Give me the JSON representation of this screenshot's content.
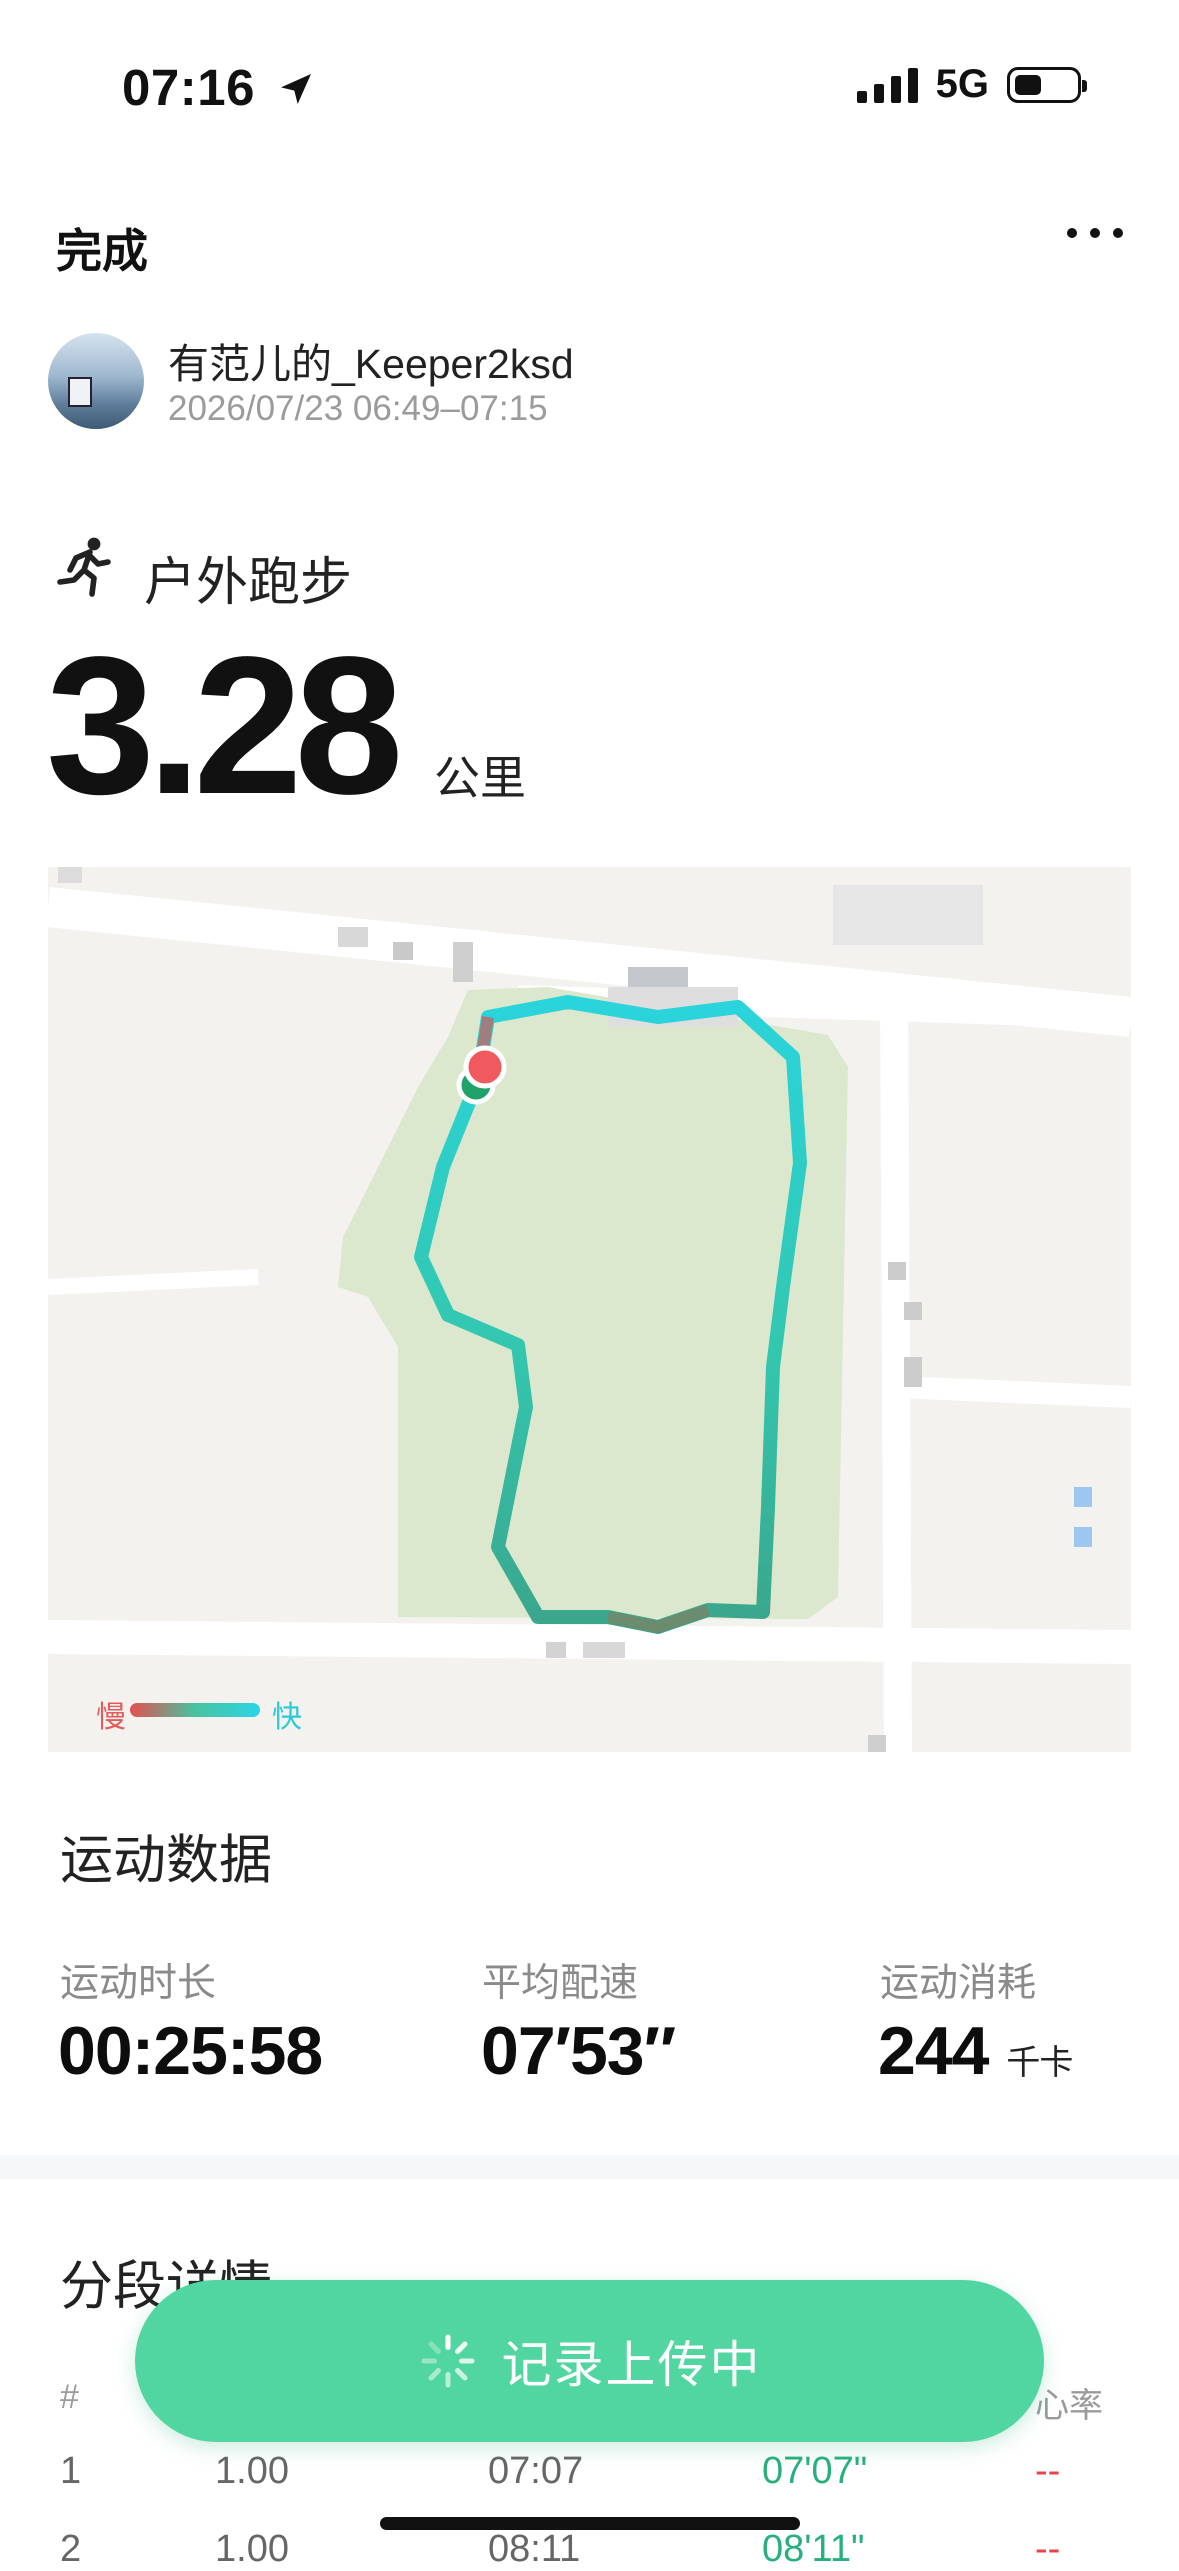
{
  "status_bar": {
    "time": "07:16",
    "network": "5G"
  },
  "header": {
    "done_label": "完成"
  },
  "user": {
    "name": "有范儿的_Keeper2ksd",
    "datetime": "2026/07/23 06:49–07:15"
  },
  "activity": {
    "sport": "户外跑步",
    "distance": "3.28",
    "distance_unit": "公里"
  },
  "map": {
    "legend_slow": "慢",
    "legend_fast": "快"
  },
  "stats": {
    "title": "运动数据",
    "items": [
      {
        "label": "运动时长",
        "value": "00:25:58",
        "unit": ""
      },
      {
        "label": "平均配速",
        "value": "07′53″",
        "unit": ""
      },
      {
        "label": "运动消耗",
        "value": "244",
        "unit": "千卡"
      }
    ]
  },
  "splits": {
    "title": "分段详情",
    "headers": [
      "#",
      "",
      "",
      "",
      "心率"
    ],
    "rows": [
      {
        "index": "1",
        "km": "1.00",
        "time": "07:07",
        "pace": "07'07\"",
        "hr": "--"
      },
      {
        "index": "2",
        "km": "1.00",
        "time": "08:11",
        "pace": "08'11\"",
        "hr": "--"
      }
    ]
  },
  "upload": {
    "label": "记录上传中"
  },
  "colors": {
    "accent": "#51d6a1",
    "pace_green": "#27b07c",
    "hr_red": "#e64545",
    "route": "#2ed3c4"
  }
}
